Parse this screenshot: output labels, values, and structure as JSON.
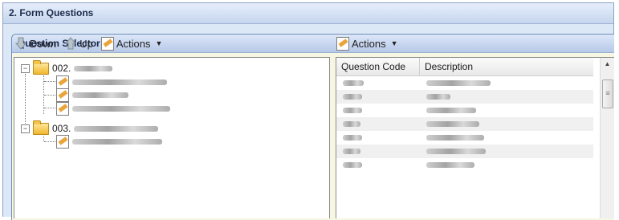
{
  "outer_panel": {
    "title": "2. Form Questions"
  },
  "selector_panel": {
    "title": "Question Selector"
  },
  "left_toolbar": {
    "down_label": "Down",
    "up_label": "Up",
    "actions_label": "Actions"
  },
  "right_toolbar": {
    "actions_label": "Actions"
  },
  "tree": {
    "nodes": [
      {
        "label": "002."
      },
      {
        "label": "003."
      }
    ]
  },
  "grid": {
    "columns": [
      "Question Code",
      "Description"
    ]
  },
  "icons": {
    "down": "arrow-down-icon",
    "up": "arrow-up-icon",
    "actions": "edit-document-icon",
    "folder": "folder-icon",
    "question": "question-document-icon"
  },
  "colors": {
    "header_blue": "#c6d6ee",
    "panel_cream": "#f7f6e2",
    "folder_gold": "#f0b62d"
  }
}
